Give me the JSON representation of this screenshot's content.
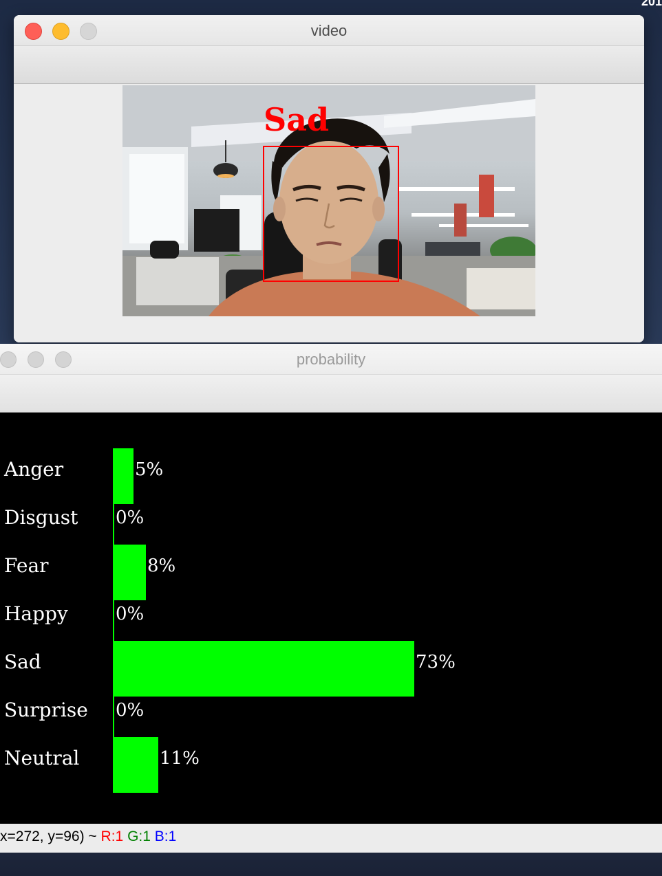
{
  "desktop": {
    "corner_text": "201"
  },
  "video_window": {
    "title": "video",
    "detection_label": "Sad",
    "colors": {
      "box": "#ff0000",
      "label": "#ff0000"
    }
  },
  "probability_window": {
    "title": "probability",
    "bar_color": "#00ff00",
    "emotions": [
      {
        "label": "Anger",
        "percent_text": "5%",
        "value": 5
      },
      {
        "label": "Disgust",
        "percent_text": "0%",
        "value": 0
      },
      {
        "label": "Fear",
        "percent_text": "8%",
        "value": 8
      },
      {
        "label": "Happy",
        "percent_text": "0%",
        "value": 0
      },
      {
        "label": "Sad",
        "percent_text": "73%",
        "value": 73
      },
      {
        "label": "Surprise",
        "percent_text": "0%",
        "value": 0
      },
      {
        "label": "Neutral",
        "percent_text": "11%",
        "value": 11
      }
    ]
  },
  "status_bar": {
    "coords": "x=272, y=96) ~ ",
    "r": "R:1",
    "g": "G:1",
    "b": "B:1",
    "colors": {
      "r": "#ff0000",
      "g": "#008000",
      "b": "#0000ff"
    }
  }
}
